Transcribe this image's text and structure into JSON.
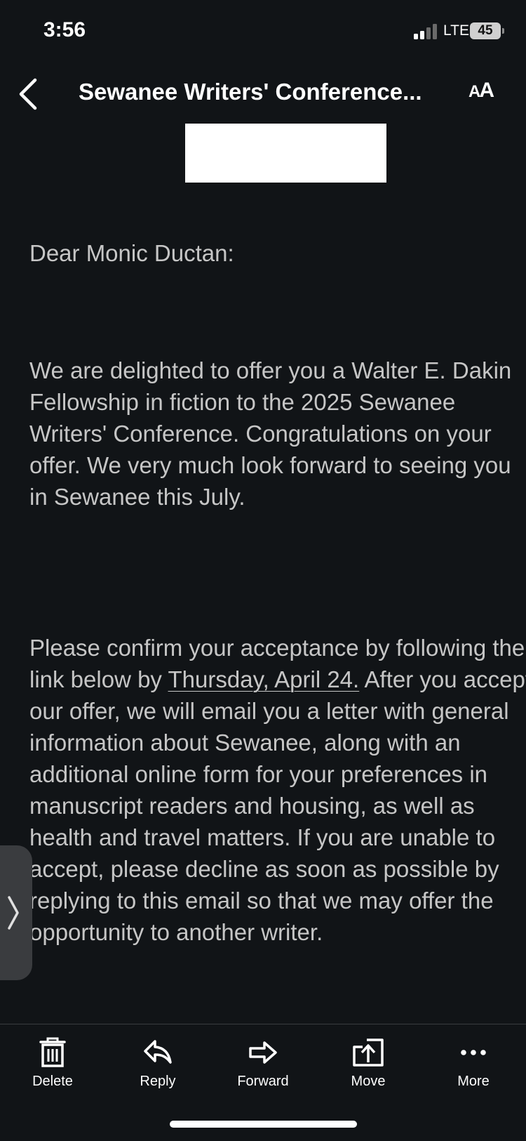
{
  "status_bar": {
    "time": "3:56",
    "network": "LTE",
    "battery": "45"
  },
  "nav": {
    "title": "Sewanee Writers' Conference...",
    "text_size_label_small": "A",
    "text_size_label_large": "A"
  },
  "email": {
    "greeting": "Dear Monic Ductan:",
    "paragraph1": "We are delighted to offer you a Walter E. Dakin Fellowship in fiction to the 2025 Sewanee Writers' Conference. Congratulations on your offer. We very much look forward to seeing you in Sewanee this July.",
    "paragraph2_before": "Please confirm your acceptance by following the link below by ",
    "paragraph2_deadline": "Thursday, April 24.",
    "paragraph2_after": " After you accept our offer, we will email you a letter with general information about Sewanee, along with an additional online form for your preferences in manuscript readers and housing, as well as health and travel matters. If you are unable to accept, please decline as soon as possible by replying to this email so that we may offer the opportunity to another writer."
  },
  "toolbar": {
    "delete_label": "Delete",
    "reply_label": "Reply",
    "forward_label": "Forward",
    "move_label": "Move",
    "more_label": "More"
  },
  "icons": {
    "back": "chevron-left-icon",
    "text_size": "text-size-icon",
    "delete": "trash-icon",
    "reply": "reply-arrow-icon",
    "forward": "forward-arrow-icon",
    "move": "folder-move-icon",
    "more": "ellipsis-icon",
    "side_handle": "chevron-right-icon"
  }
}
